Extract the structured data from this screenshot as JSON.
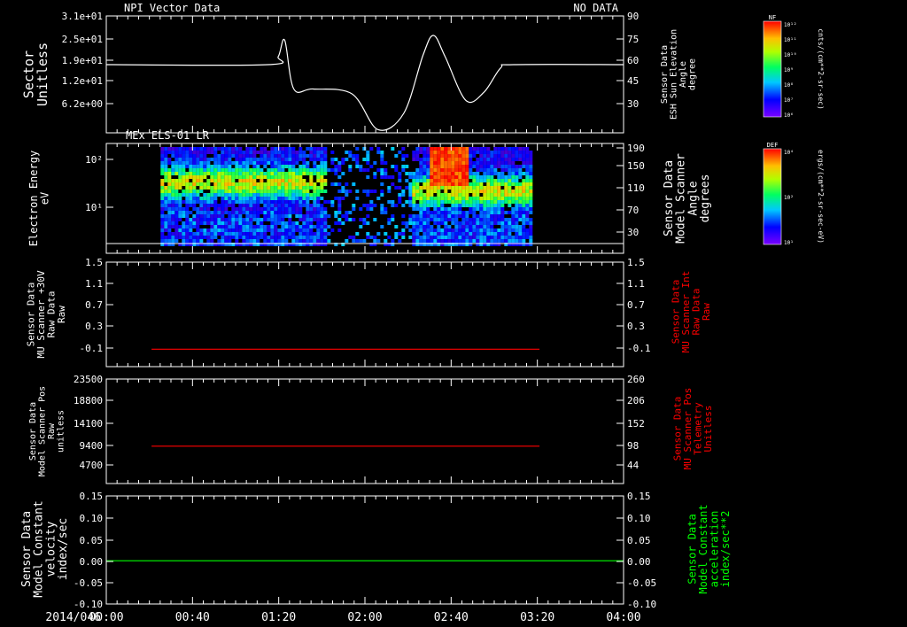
{
  "figure": {
    "date_label": "2014/046",
    "time_ticks": [
      "00:00",
      "00:40",
      "01:20",
      "02:00",
      "02:40",
      "03:20",
      "04:00"
    ]
  },
  "colors": {
    "background": "#000000",
    "axis": "#ffffff",
    "red": "#ff0000",
    "green": "#00ff00"
  },
  "chart_data": [
    {
      "type": "line",
      "title": "NPI Vector Data",
      "status": "NO DATA",
      "ylabel_left": [
        "Sector",
        "Unitless"
      ],
      "left_ticks": [
        "3.1e+01",
        "2.5e+01",
        "1.9e+01",
        "1.2e+01",
        "6.2e+00"
      ],
      "ylabel_right": [
        "Sensor Data",
        "ESH Sun Elevation",
        "Angle",
        "degree"
      ],
      "right_ticks": [
        "90",
        "75",
        "60",
        "45",
        "30"
      ],
      "ylim": [
        18,
        90
      ],
      "series": [
        {
          "color": "#ffffff",
          "x": [
            0,
            1.25,
            1.33,
            1.38,
            1.45,
            1.6,
            1.9,
            2.1,
            2.3,
            2.45,
            2.53,
            2.62,
            2.78,
            2.92,
            3.05,
            3.15,
            4.0
          ],
          "y": [
            60,
            60,
            65,
            75,
            45,
            45,
            42,
            20,
            30,
            66,
            78,
            65,
            38,
            43,
            58,
            60,
            60
          ]
        }
      ]
    },
    {
      "type": "heatmap",
      "title": "MEx ELS-01 LR",
      "ylabel_left": [
        "Electron Energy",
        "eV"
      ],
      "left_ticks": [
        "10²",
        "10¹"
      ],
      "ylabel_right": [
        "Sensor Data",
        "Model Scanner",
        "Angle",
        "degrees"
      ],
      "right_ticks": [
        "190",
        "150",
        "110",
        "70",
        "30"
      ],
      "colorbar": {
        "label": "DEF",
        "units": "ergs/(cm**2-sr-sec-eV)",
        "ticks": [
          "10⁴",
          "10²",
          "10¹"
        ]
      },
      "time_range": [
        0.42,
        3.28
      ]
    },
    {
      "type": "line",
      "ylabel_left": [
        "Sensor Data",
        "MU Scanner +30V",
        "Raw Data",
        "Raw"
      ],
      "left_ticks": [
        "1.5",
        "1.1",
        "0.7",
        "0.3",
        "-0.1"
      ],
      "ylabel_right": [
        "Sensor Data",
        "MU Scanner Int",
        "Raw Data",
        "Raw"
      ],
      "right_ticks": [
        "1.5",
        "1.1",
        "0.7",
        "0.3",
        "-0.1"
      ],
      "ylim": [
        -0.3,
        1.5
      ],
      "series": [
        {
          "color": "#ff0000",
          "x": [
            0.35,
            3.35
          ],
          "y": [
            0.0,
            0.0
          ]
        }
      ]
    },
    {
      "type": "line",
      "ylabel_left": [
        "Sensor Data",
        "Model Scanner Pos",
        "Raw",
        "unitless"
      ],
      "left_ticks": [
        "23500",
        "18800",
        "14100",
        "9400",
        "4700"
      ],
      "ylabel_right": [
        "Sensor Data",
        "MU Scanner Pos",
        "Telemetry",
        "Unitless"
      ],
      "right_ticks": [
        "260",
        "206",
        "152",
        "98",
        "44"
      ],
      "ylim": [
        0,
        23500
      ],
      "series": [
        {
          "color": "#ff0000",
          "x": [
            0.35,
            3.35
          ],
          "y": [
            8400,
            8400
          ]
        }
      ]
    },
    {
      "type": "line",
      "ylabel_left": [
        "Sensor Data",
        "Model Constant",
        "velocity",
        "index/sec"
      ],
      "left_ticks": [
        "0.15",
        "0.10",
        "0.05",
        "0.00",
        "-0.05",
        "-0.10"
      ],
      "ylabel_right": [
        "Sensor Data",
        "Model Constant",
        "acceleration",
        "index/sec**2"
      ],
      "right_ticks": [
        "0.15",
        "0.10",
        "0.05",
        "0.00",
        "-0.05",
        "-0.10"
      ],
      "ylim": [
        -0.1,
        0.15
      ],
      "series": [
        {
          "color": "#00ff00",
          "x": [
            0,
            4
          ],
          "y": [
            0,
            0
          ]
        }
      ]
    }
  ],
  "colorbar_nf": {
    "label": "NF",
    "units": "cnts/(cm**2-sr-sec)",
    "ticks": [
      "10¹²",
      "10¹¹",
      "10¹⁰",
      "10⁹",
      "10⁸",
      "10⁷",
      "10⁶"
    ]
  }
}
